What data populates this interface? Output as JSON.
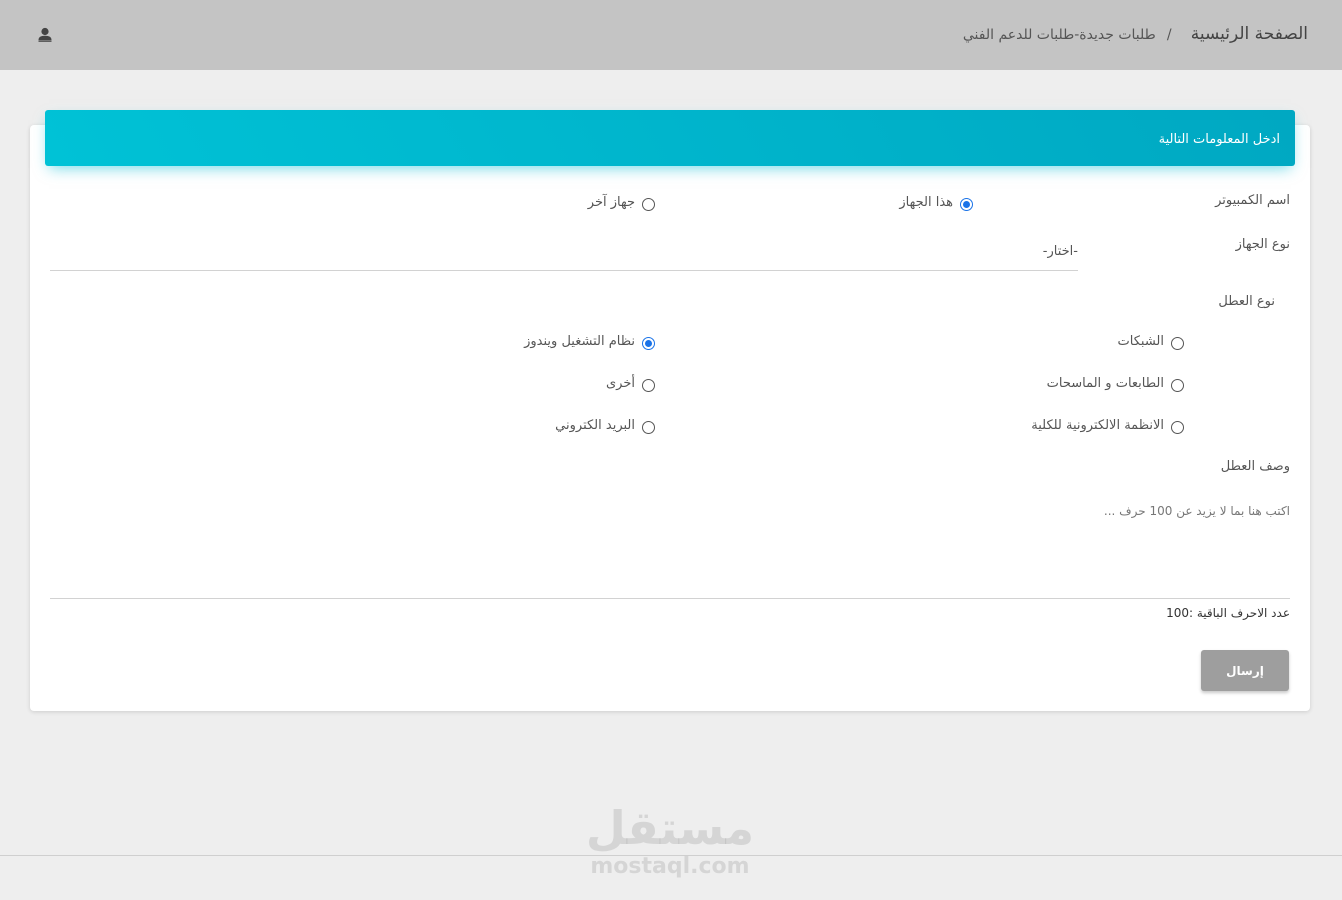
{
  "header": {
    "breadcrumb_home": "الصفحة الرئيسية",
    "breadcrumb_separator": "/",
    "breadcrumb_current": "طلبات جديدة-طلبات للدعم الفني",
    "user_icon": "user-icon"
  },
  "form": {
    "title": "ادخل المعلومات التالية",
    "computer_name_label": "اسم الكمبيوتر",
    "computer_options": [
      {
        "label": "هذا الجهاز",
        "checked": true
      },
      {
        "label": "جهاز آخر",
        "checked": false
      }
    ],
    "device_type_label": "نوع الجهاز",
    "device_type_value": "-اختار-",
    "fault_type_label": "نوع العطل",
    "fault_options": [
      {
        "label": "الشبكات",
        "checked": false
      },
      {
        "label": "نظام التشغيل ويندوز",
        "checked": true
      },
      {
        "label": "الطابعات و الماسحات",
        "checked": false
      },
      {
        "label": "أخرى",
        "checked": false
      },
      {
        "label": "الانظمة الالكترونية للكلية",
        "checked": false
      },
      {
        "label": "البريد الكتروني",
        "checked": false
      }
    ],
    "fault_description_label": "وصف العطل",
    "description_placeholder": "اكتب هنا بما لا يزيد عن 100 حرف ...",
    "remaining_chars_label": "عدد الاحرف الباقية :100",
    "submit_label": "إرسال"
  },
  "watermark": {
    "logo": "مستقل",
    "url": "mostaql.com"
  },
  "colors": {
    "header_gradient_start": "#00c2d6",
    "header_gradient_end": "#00a8c2",
    "radio_checked": "#1a73e8",
    "submit_button": "#9e9e9e",
    "topbar": "#c4c4c4"
  }
}
